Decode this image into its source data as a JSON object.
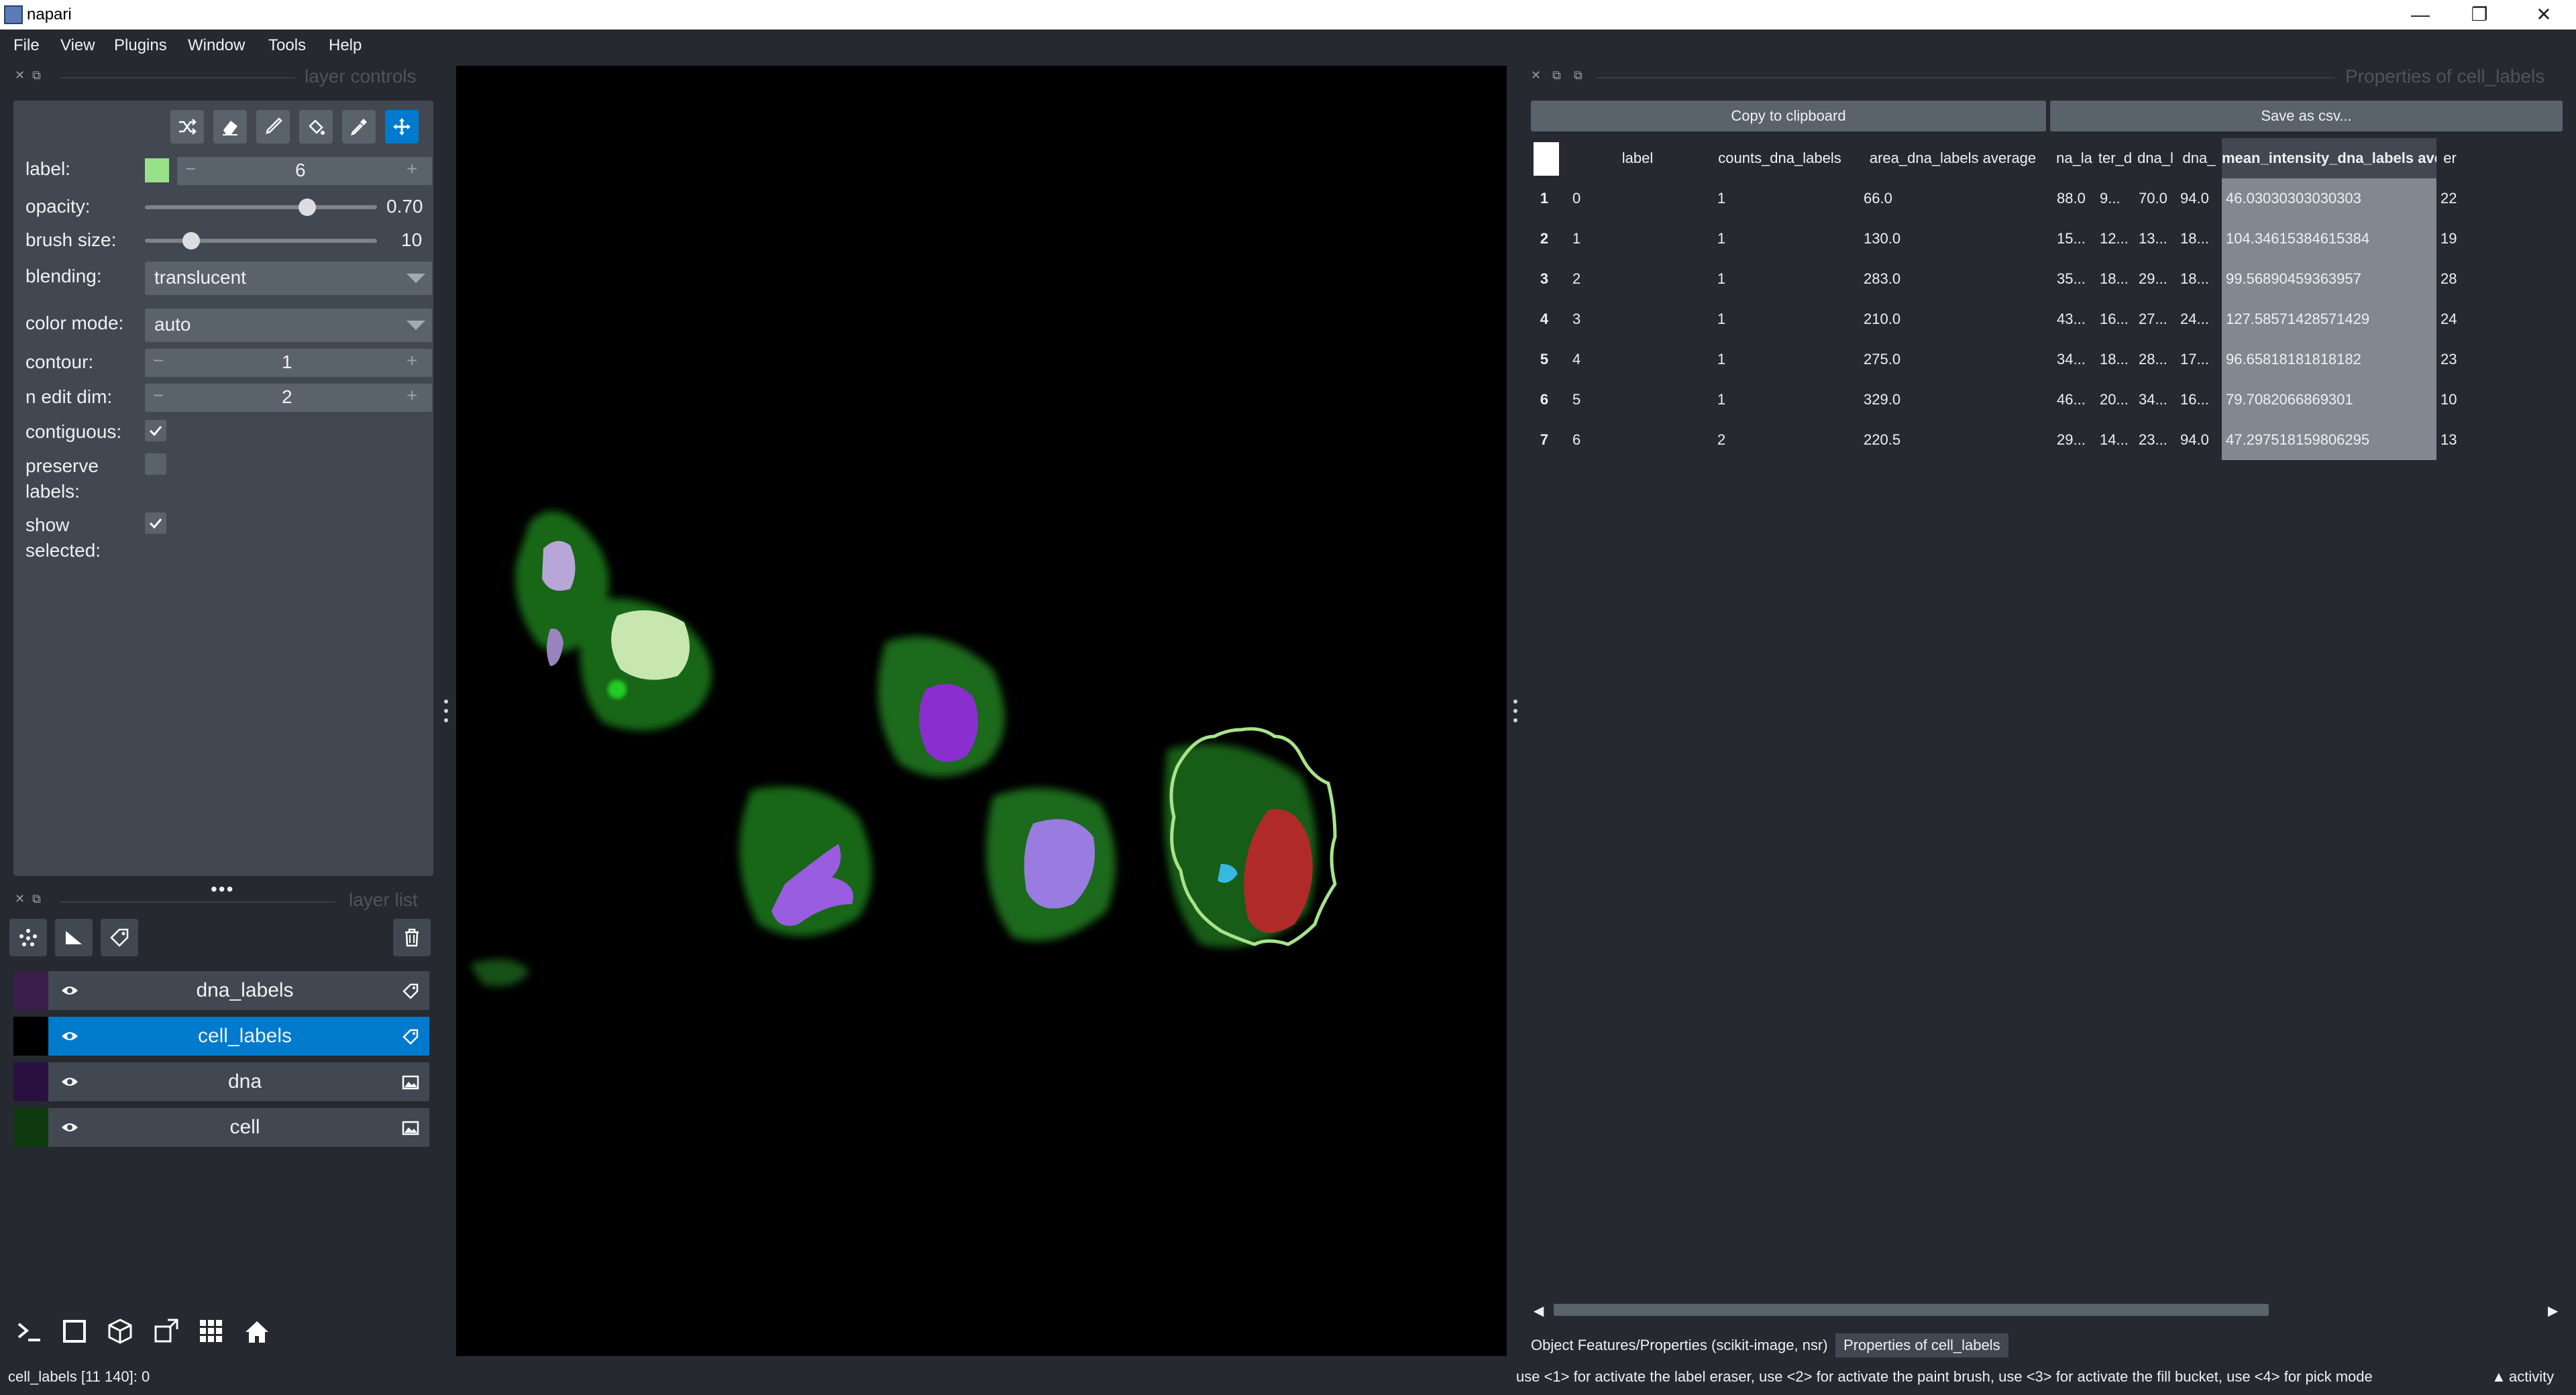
{
  "window": {
    "title": "napari",
    "minimize": "—",
    "maximize": "❐",
    "close": "✕"
  },
  "menu": [
    "File",
    "View",
    "Plugins",
    "Window",
    "Tools",
    "Help"
  ],
  "layer_controls": {
    "title": "layer controls",
    "label_label": "label:",
    "label_value": "6",
    "label_color": "#98e08a",
    "opacity_label": "opacity:",
    "opacity_value": "0.70",
    "opacity_fraction": 0.7,
    "brush_label": "brush size:",
    "brush_value": "10",
    "brush_fraction": 0.2,
    "blending_label": "blending:",
    "blending_value": "translucent",
    "color_mode_label": "color mode:",
    "color_mode_value": "auto",
    "contour_label": "contour:",
    "contour_value": "1",
    "n_edit_dim_label": "n edit dim:",
    "n_edit_dim_value": "2",
    "contiguous_label": "contiguous:",
    "contiguous_checked": true,
    "preserve_label": "preserve labels:",
    "preserve_checked": false,
    "show_selected_label": "show selected:",
    "show_selected_checked": true,
    "minus": "−",
    "plus": "+"
  },
  "layer_list": {
    "title": "layer list",
    "layers": [
      {
        "name": "dna_labels",
        "type": "labels",
        "selected": false
      },
      {
        "name": "cell_labels",
        "type": "labels",
        "selected": true
      },
      {
        "name": "dna",
        "type": "image",
        "selected": false
      },
      {
        "name": "cell",
        "type": "image",
        "selected": false
      }
    ]
  },
  "properties": {
    "title": "Properties of cell_labels",
    "copy_button": "Copy to clipboard",
    "save_button": "Save as csv...",
    "columns": [
      "label",
      "counts_dna_labels",
      "area_dna_labels average",
      "na_la",
      "ter_d",
      "dna_l",
      "dna_",
      "mean_intensity_dna_labels average",
      "er"
    ],
    "rows": [
      [
        "1",
        "0",
        "1",
        "66.0",
        "88.0",
        "9...",
        "70.0",
        "94.0",
        "46.03030303030303",
        "22"
      ],
      [
        "2",
        "1",
        "1",
        "130.0",
        "15...",
        "12...",
        "13...",
        "18...",
        "104.34615384615384",
        "19"
      ],
      [
        "3",
        "2",
        "1",
        "283.0",
        "35...",
        "18...",
        "29...",
        "18...",
        "99.56890459363957",
        "28"
      ],
      [
        "4",
        "3",
        "1",
        "210.0",
        "43...",
        "16...",
        "27...",
        "24...",
        "127.58571428571429",
        "24"
      ],
      [
        "5",
        "4",
        "1",
        "275.0",
        "34...",
        "18...",
        "28...",
        "17...",
        "96.65818181818182",
        "23"
      ],
      [
        "6",
        "5",
        "1",
        "329.0",
        "46...",
        "20...",
        "34...",
        "16...",
        "79.7082066869301",
        "10"
      ],
      [
        "7",
        "6",
        "2",
        "220.5",
        "29...",
        "14...",
        "23...",
        "94.0",
        "47.297518159806295",
        "13"
      ]
    ],
    "tabs": [
      "Object Features/Properties (scikit-image, nsr)",
      "Properties of cell_labels"
    ]
  },
  "status": {
    "left": "cell_labels [11 140]: 0",
    "right": "use <1> for activate the label eraser, use <2> for activate the paint brush, use <3> for activate the fill bucket, use <4> for pick mode",
    "activity": "activity",
    "activity_arrow": "▲"
  }
}
